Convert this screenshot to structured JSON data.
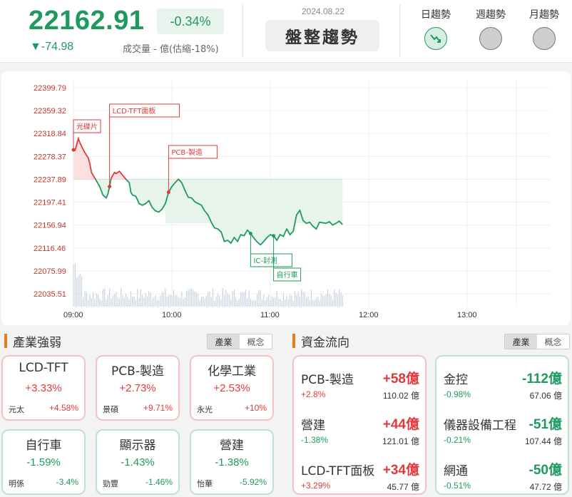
{
  "header": {
    "index_value": "22162.91",
    "change_pct": "-0.34%",
    "change_pts": "▼-74.98",
    "volume_text": "成交量 - 億(估縮-18%)",
    "date": "2024.08.22",
    "trend_label": "盤整趨勢",
    "trends": [
      {
        "label": "日趨勢",
        "state": "active"
      },
      {
        "label": "週趨勢",
        "state": "inactive"
      },
      {
        "label": "月趨勢",
        "state": "inactive"
      }
    ]
  },
  "colors": {
    "up": "#e03a3a",
    "down": "#1f9a5e",
    "accent": "#e67e22"
  },
  "chart_data": {
    "type": "line",
    "title": "",
    "reference_value": 22237.89,
    "y_ticks": [
      22399.79,
      22359.32,
      22318.84,
      22278.37,
      22237.89,
      22197.41,
      22156.94,
      22116.46,
      22075.99,
      22035.51
    ],
    "x_ticks": [
      "09:00",
      "10:00",
      "11:00",
      "12:00",
      "13:00"
    ],
    "x_range_minutes": [
      0,
      270
    ],
    "series": [
      {
        "t": [
          0,
          1,
          2,
          3,
          4,
          5,
          6,
          7,
          8,
          9,
          10,
          11,
          12,
          14,
          16,
          18,
          20,
          21,
          22,
          23,
          24,
          25,
          26,
          28,
          30,
          32,
          34,
          35,
          36,
          38,
          40,
          42,
          44,
          46,
          48,
          50,
          52,
          54,
          56,
          58,
          60,
          62,
          64,
          66,
          68,
          70,
          72,
          74,
          76,
          78,
          80,
          82,
          84,
          86,
          88,
          90,
          92,
          94,
          96,
          98,
          100,
          102,
          104,
          106,
          108,
          110,
          112,
          114,
          116,
          118,
          120,
          122,
          124,
          126,
          128,
          130,
          132,
          134,
          136,
          138,
          140,
          142,
          144,
          146,
          148,
          150,
          152,
          154,
          156,
          158,
          160,
          162,
          164
        ],
        "v": [
          22290,
          22289,
          22300,
          22310,
          22302,
          22296,
          22290,
          22285,
          22280,
          22276,
          22265,
          22250,
          22245,
          22235,
          22225,
          22210,
          22205,
          22212,
          22225,
          22240,
          22245,
          22250,
          22248,
          22252,
          22245,
          22238,
          22232,
          22215,
          22210,
          22208,
          22195,
          22192,
          22195,
          22200,
          22188,
          22182,
          22180,
          22185,
          22195,
          22215,
          22225,
          22232,
          22238,
          22232,
          22218,
          22206,
          22205,
          22198,
          22195,
          22192,
          22182,
          22175,
          22162,
          22152,
          22150,
          22145,
          22128,
          22130,
          22125,
          22135,
          22128,
          22140,
          22138,
          22148,
          22142,
          22134,
          22127,
          22122,
          22128,
          22135,
          22140,
          22138,
          22130,
          22140,
          22137,
          22150,
          22140,
          22146,
          22175,
          22183,
          22165,
          22160,
          22162,
          22155,
          22150,
          22162,
          22161,
          22160,
          22163,
          22157,
          22160,
          22164,
          22158
        ]
      }
    ],
    "volume_note": "per-minute volume bars below the price line",
    "annotations": [
      {
        "label": "光碟片",
        "t": 0,
        "direction": "up"
      },
      {
        "label": "LCD-TFT面板",
        "t": 22,
        "direction": "up"
      },
      {
        "label": "PCB-製造",
        "t": 58,
        "direction": "up"
      },
      {
        "label": "IC-封測",
        "t": 108,
        "direction": "down"
      },
      {
        "label": "自行車",
        "t": 122,
        "direction": "down"
      }
    ]
  },
  "industry_strength": {
    "title": "產業強弱",
    "toggle": [
      "產業",
      "概念"
    ],
    "cards": [
      {
        "name": "LCD-TFT",
        "pct": "+3.33%",
        "stock": "元太",
        "stock_pct": "+4.58%",
        "dir": "up"
      },
      {
        "name": "PCB-製造",
        "pct": "+2.73%",
        "stock": "景碩",
        "stock_pct": "+9.71%",
        "dir": "up"
      },
      {
        "name": "化學工業",
        "pct": "+2.53%",
        "stock": "永光",
        "stock_pct": "+10%",
        "dir": "up"
      },
      {
        "name": "自行車",
        "pct": "-1.59%",
        "stock": "明係",
        "stock_pct": "-3.4%",
        "dir": "down"
      },
      {
        "name": "顯示器",
        "pct": "-1.43%",
        "stock": "勁豐",
        "stock_pct": "-1.46%",
        "dir": "down"
      },
      {
        "name": "營建",
        "pct": "-1.38%",
        "stock": "怡華",
        "stock_pct": "-5.92%",
        "dir": "down"
      }
    ]
  },
  "fund_flow": {
    "title": "資金流向",
    "toggle": [
      "產業",
      "概念"
    ],
    "inflow": [
      {
        "name": "PCB-製造",
        "amount": "+58億",
        "pct": "+2.8%",
        "volume": "110.02 億"
      },
      {
        "name": "營建",
        "amount": "+44億",
        "pct": "-1.38%",
        "volume": "121.01 億"
      },
      {
        "name": "LCD-TFT面板",
        "amount": "+34億",
        "pct": "+3.29%",
        "volume": "45.77 億"
      }
    ],
    "outflow": [
      {
        "name": "金控",
        "amount": "-112億",
        "pct": "-0.98%",
        "volume": "67.06 億"
      },
      {
        "name": "儀器設備工程",
        "amount": "-51億",
        "pct": "-0.21%",
        "volume": "107.44 億"
      },
      {
        "name": "網通",
        "amount": "-50億",
        "pct": "-0.51%",
        "volume": "47.72 億"
      }
    ]
  }
}
